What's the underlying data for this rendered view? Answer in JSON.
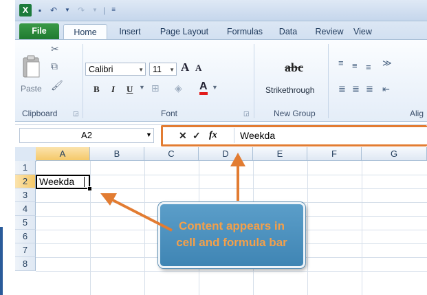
{
  "title_bar": {
    "logo_letter": "X",
    "qat_icons": [
      "save-icon",
      "undo-icon",
      "redo-icon",
      "customize-icon"
    ]
  },
  "tabs": [
    {
      "label": "File"
    },
    {
      "label": "Home"
    },
    {
      "label": "Insert"
    },
    {
      "label": "Page Layout"
    },
    {
      "label": "Formulas"
    },
    {
      "label": "Data"
    },
    {
      "label": "Review"
    },
    {
      "label": "View"
    }
  ],
  "ribbon": {
    "clipboard": {
      "paste_label": "Paste",
      "group_label": "Clipboard"
    },
    "font": {
      "font_name": "Calibri",
      "font_size": "11",
      "grow_label": "A",
      "shrink_label": "A",
      "bold": "B",
      "italic": "I",
      "underline": "U",
      "font_color": "A",
      "group_label": "Font"
    },
    "new_group": {
      "abc": "abc",
      "strikethrough_label": "Strikethrough",
      "group_label": "New Group"
    },
    "alignment": {
      "group_label": "Alig"
    }
  },
  "formula_bar": {
    "name_box": "A2",
    "cancel": "✕",
    "enter": "✓",
    "fx": "fx",
    "content": "Weekda"
  },
  "grid": {
    "columns": [
      "A",
      "B",
      "C",
      "D",
      "E",
      "F",
      "G"
    ],
    "rows": [
      "1",
      "2",
      "3",
      "4",
      "5",
      "6",
      "7",
      "8"
    ],
    "active_cell_value": "Weekda"
  },
  "callout": {
    "line1": "Content appears in",
    "line2": "cell and formula bar"
  },
  "colors": {
    "highlight": "#e27c32",
    "callout_bg": "#4a8fbe",
    "callout_text": "#f4a04a",
    "file_tab": "#2a8a3c",
    "selected_header": "#f5c969"
  }
}
